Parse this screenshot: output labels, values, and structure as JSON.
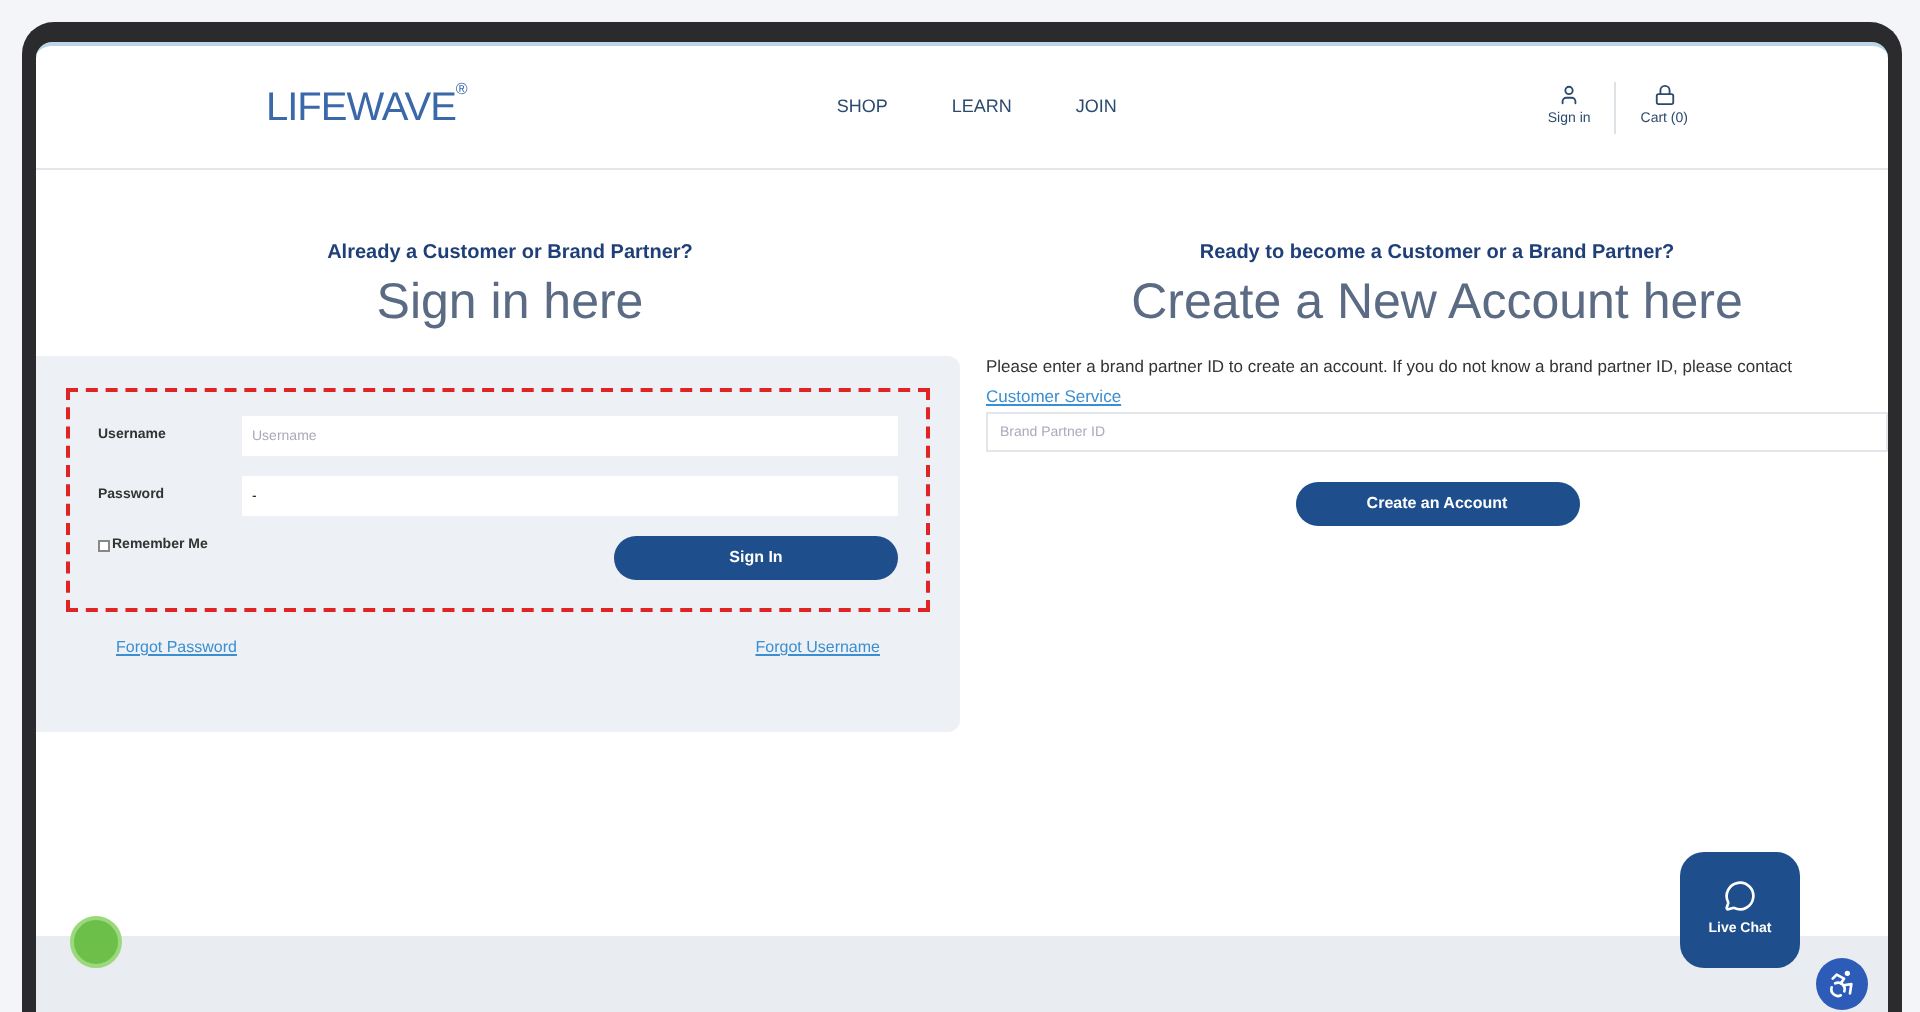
{
  "header": {
    "logo": "LIFEWAVE",
    "logo_mark": "®",
    "nav": [
      "SHOP",
      "LEARN",
      "JOIN"
    ],
    "account": "Sign in",
    "cart": "Cart (0)"
  },
  "signin": {
    "eyebrow": "Already a Customer or Brand Partner?",
    "title": "Sign in here",
    "fields": [
      {
        "label": "Username",
        "placeholder": "Username"
      },
      {
        "label": "Password",
        "value": "-"
      }
    ],
    "remember": {
      "label": "Remember Me",
      "checked": false
    },
    "button": "Sign In",
    "links": [
      "Forgot Password",
      "Forgot Username"
    ]
  },
  "create": {
    "eyebrow": "Ready to become a Customer or a Brand Partner?",
    "title": "Create a New Account here",
    "note": "Please enter a brand partner ID to create an account. If you do not know a brand partner ID, please contact",
    "note_link": "Customer Service",
    "field": {
      "placeholder": "Brand Partner ID"
    },
    "button": "Create an Account"
  },
  "live_chat": {
    "label": "Live Chat"
  }
}
